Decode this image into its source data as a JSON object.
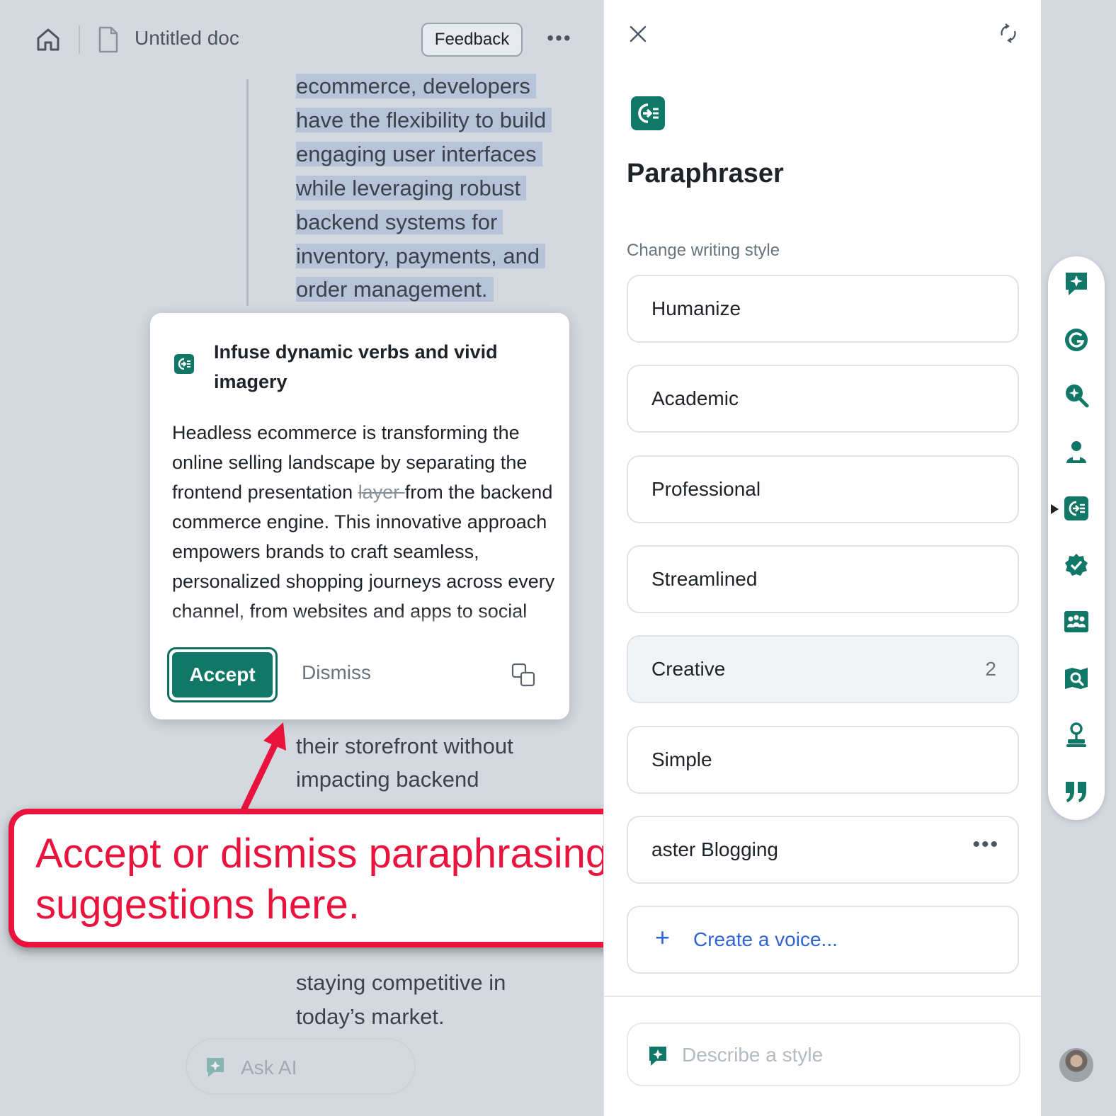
{
  "colors": {
    "accent": "#117767",
    "annotation": "#e8143d",
    "link": "#2f64d9",
    "selection": "#b7c3d9"
  },
  "topbar": {
    "doc_title": "Untitled doc",
    "feedback_label": "Feedback",
    "more_label": "•••",
    "icons": [
      "home-icon",
      "document-icon",
      "more-icon"
    ]
  },
  "document": {
    "selected_lines": [
      "ecommerce, developers",
      "have the flexibility to build",
      "engaging user interfaces",
      "while leveraging robust",
      "backend systems for",
      "inventory, payments, and",
      "order management."
    ],
    "lower_lines": [
      "their storefront without",
      "impacting backend",
      "staying competitive in",
      "today’s market."
    ]
  },
  "ask_ai": {
    "label": "Ask AI"
  },
  "suggestion": {
    "title": "Infuse dynamic verbs and vivid imagery",
    "body_before": "Headless ecommerce is transforming the online selling landscape by separating the frontend presentation ",
    "body_struck": "layer ",
    "body_after": "from the backend commerce engine. This innovative approach empowers brands to craft seamless, personalized shopping journeys across every channel, from websites and apps to social media and beyond.",
    "accept_label": "Accept",
    "dismiss_label": "Dismiss"
  },
  "annotation": {
    "line1": "Accept or dismiss paraphrasing",
    "line2": "suggestions here."
  },
  "panel": {
    "title": "Paraphraser",
    "style_label": "Change writing style",
    "styles": [
      {
        "label": "Humanize"
      },
      {
        "label": "Academic"
      },
      {
        "label": "Professional"
      },
      {
        "label": "Streamlined"
      },
      {
        "label": "Creative",
        "count": "2",
        "active": true
      },
      {
        "label": "Simple"
      },
      {
        "label": "aster Blogging",
        "more": "•••"
      }
    ],
    "create_voice": {
      "plus": "+",
      "label": "Create a voice..."
    },
    "describe_placeholder": "Describe a style"
  },
  "rail": {
    "icons": [
      "ai-chat-icon",
      "grammarly-icon",
      "ai-search-icon",
      "reader-icon",
      "paraphraser-icon",
      "proofread-icon",
      "audience-icon",
      "reader-reactions-icon",
      "expert-review-icon",
      "citation-icon"
    ],
    "active": "paraphraser-icon"
  }
}
